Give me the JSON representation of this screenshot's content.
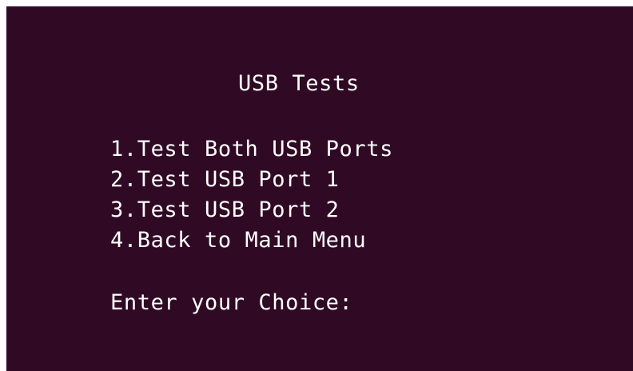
{
  "terminal": {
    "background_color": "#300a24",
    "text_color": "#ffffff",
    "title": "USB Tests",
    "menu_options": [
      "1.Test Both USB Ports",
      "2.Test USB Port 1",
      "3.Test USB Port 2",
      "4.Back to Main Menu"
    ],
    "prompt": "Enter your Choice:"
  }
}
